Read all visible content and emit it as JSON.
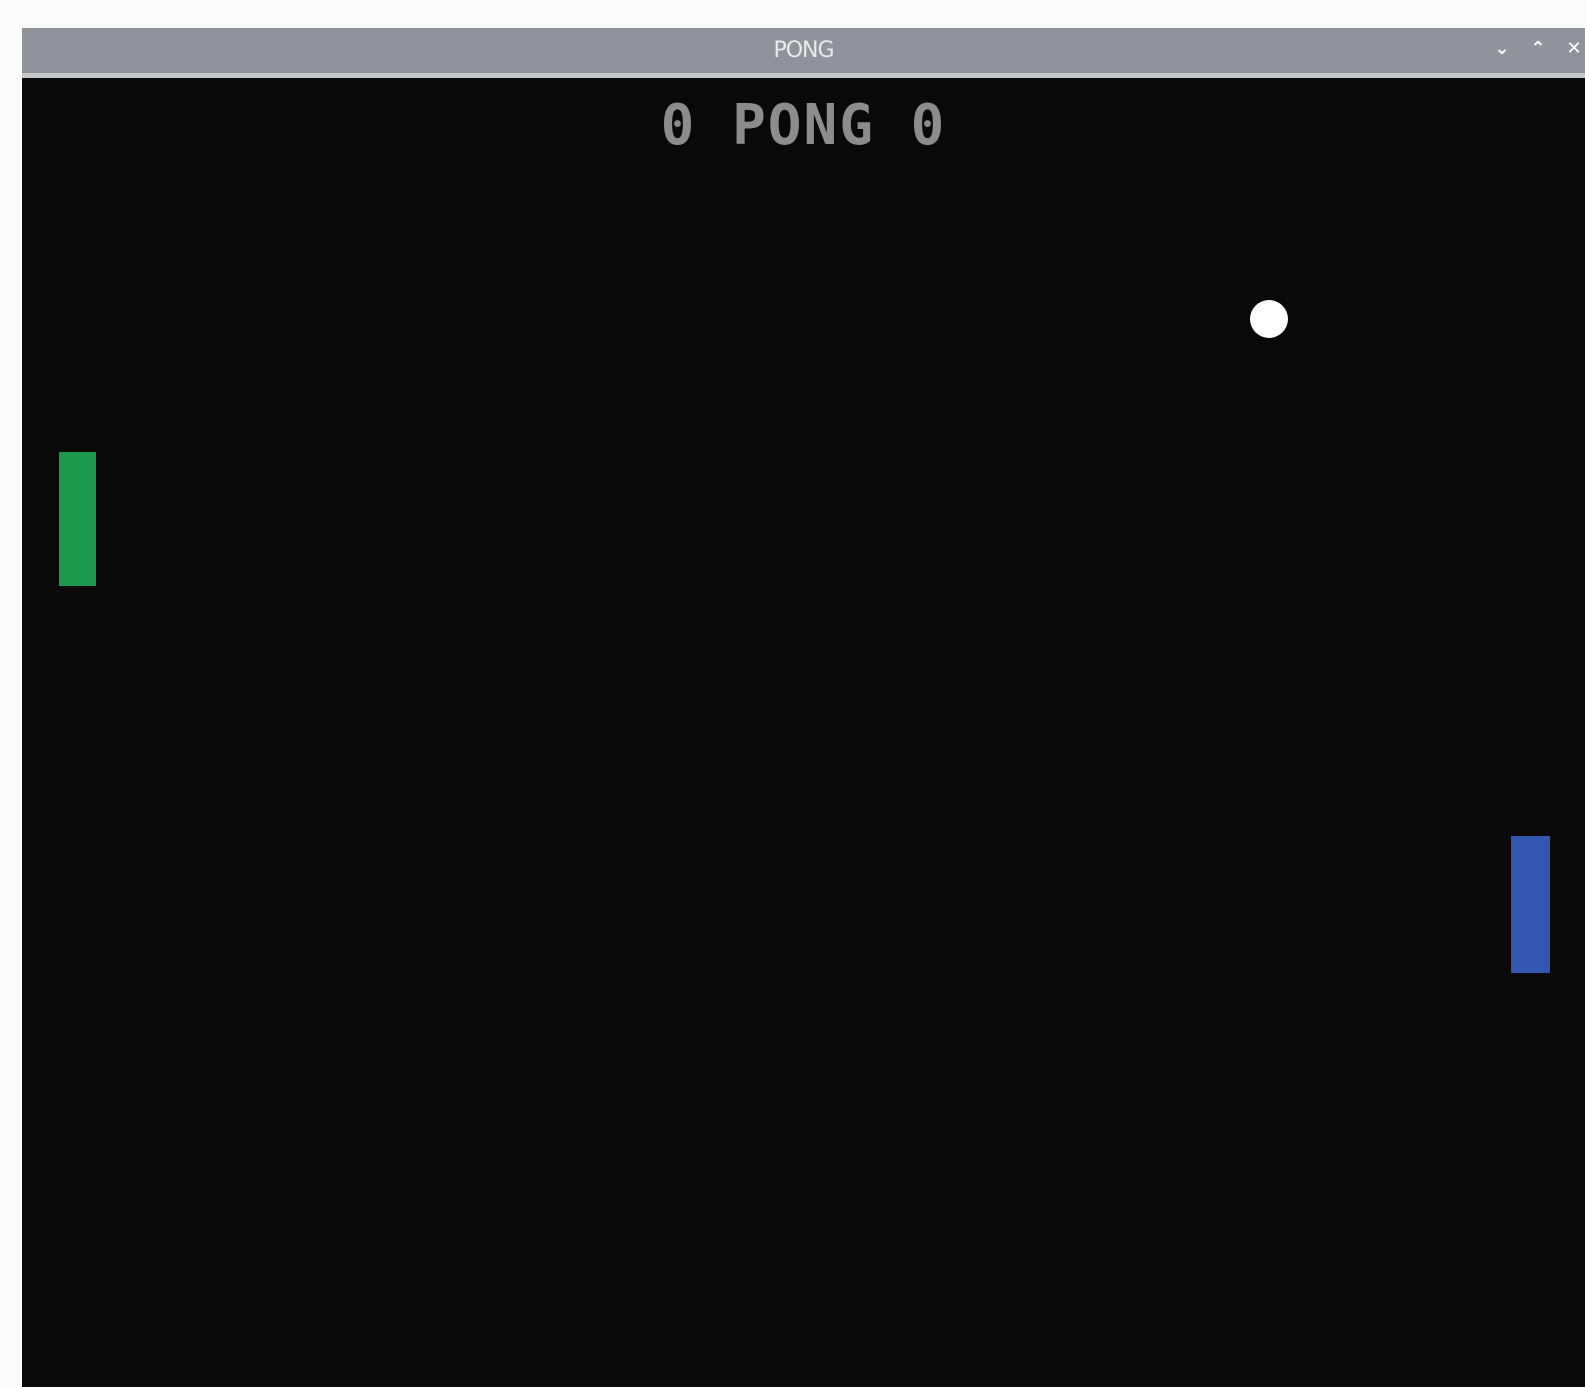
{
  "window": {
    "title": "PONG",
    "controls": {
      "minimize_icon": "chevron-down-icon",
      "maximize_icon": "chevron-up-icon",
      "close_icon": "close-icon",
      "minimize_glyph": "⌄",
      "maximize_glyph": "⌃",
      "close_glyph": "✕"
    }
  },
  "game": {
    "score_left": "0",
    "title": "PONG",
    "score_right": "0",
    "colors": {
      "background": "#090909",
      "score_text": "#8c8c8c",
      "left_paddle": "#1b9a4e",
      "right_paddle": "#3357b1",
      "ball": "#ffffff"
    }
  }
}
